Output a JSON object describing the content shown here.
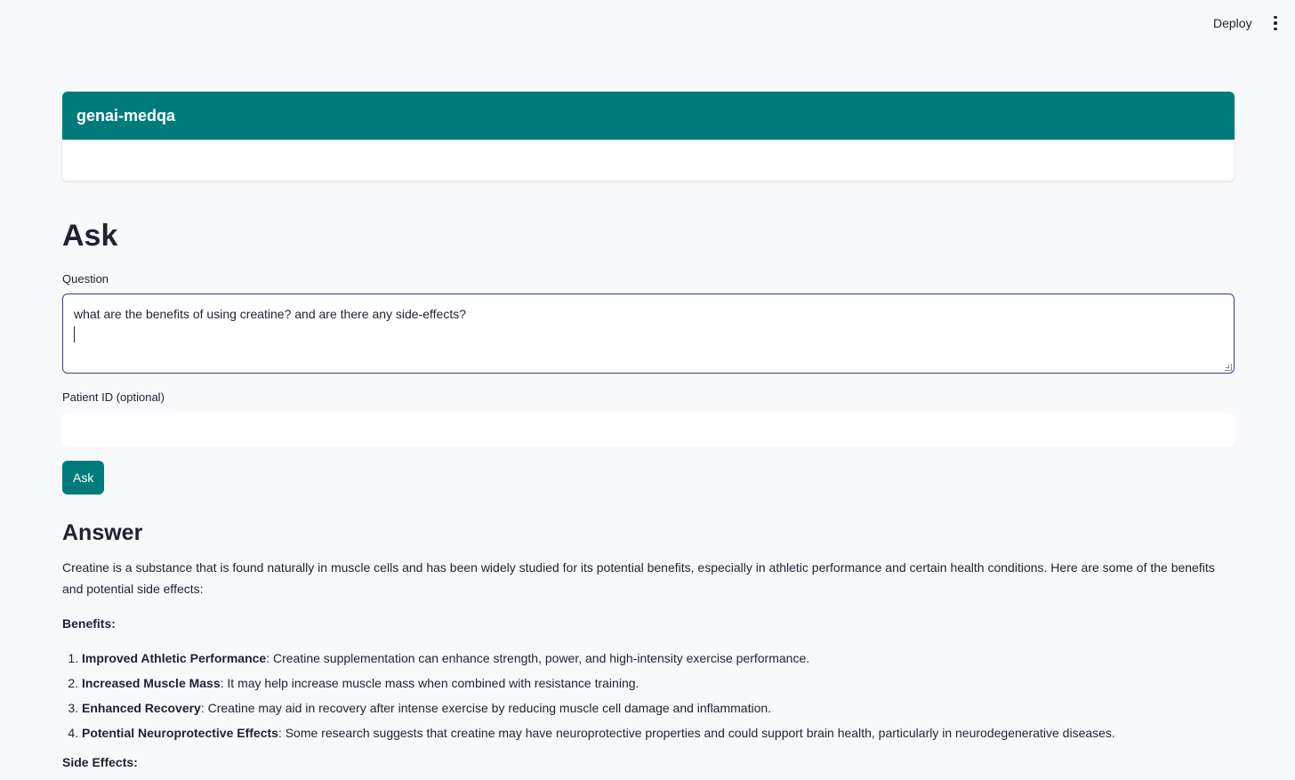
{
  "topbar": {
    "deploy_label": "Deploy",
    "menu_icon": "kebab-menu-icon"
  },
  "header": {
    "title": "genai-medqa"
  },
  "page": {
    "title": "Ask"
  },
  "form": {
    "question_label": "Question",
    "question_value": "what are the benefits of using creatine? and are there any side-effects?",
    "patient_label": "Patient ID (optional)",
    "patient_value": "",
    "ask_label": "Ask"
  },
  "answer": {
    "title": "Answer",
    "intro": "Creatine is a substance that is found naturally in muscle cells and has been widely studied for its potential benefits, especially in athletic performance and certain health conditions. Here are some of the benefits and potential side effects:",
    "benefits_heading": "Benefits:",
    "benefits": [
      {
        "term": "Improved Athletic Performance",
        "text": ": Creatine supplementation can enhance strength, power, and high-intensity exercise performance."
      },
      {
        "term": "Increased Muscle Mass",
        "text": ": It may help increase muscle mass when combined with resistance training."
      },
      {
        "term": "Enhanced Recovery",
        "text": ": Creatine may aid in recovery after intense exercise by reducing muscle cell damage and inflammation."
      },
      {
        "term": "Potential Neuroprotective Effects",
        "text": ": Some research suggests that creatine may have neuroprotective properties and could support brain health, particularly in neurodegenerative diseases."
      }
    ],
    "side_effects_heading": "Side Effects:"
  },
  "colors": {
    "accent": "#007b7b",
    "focus_border": "#3a3aa8",
    "background": "#f8f9fb"
  }
}
